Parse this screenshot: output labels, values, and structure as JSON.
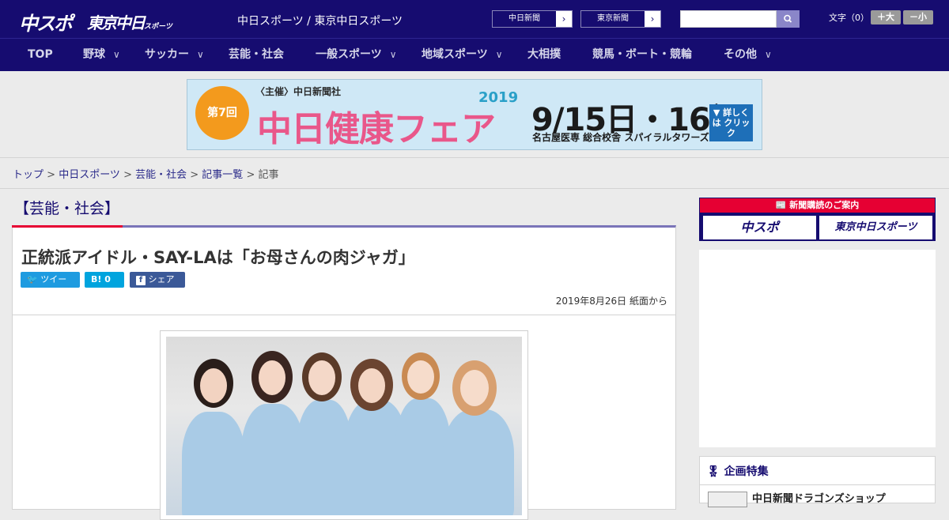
{
  "header": {
    "logo_chuspo": "中スポ",
    "logo_tokyo": "東京中日",
    "logo_tokyo_small": "スポーツ",
    "site_name": "中日スポーツ / 東京中日スポーツ",
    "link_chunichi": "中日新聞",
    "link_tokyo": "東京新聞",
    "arrow": "›",
    "search_icon": "search-icon",
    "font_label": "文字（0）",
    "font_large": "＋大",
    "font_small": "－小"
  },
  "nav": {
    "chevron": "∨",
    "items": [
      {
        "label": "TOP"
      },
      {
        "label": "野球"
      },
      {
        "label": "サッカー"
      },
      {
        "label": "芸能・社会"
      },
      {
        "label": "一般スポーツ"
      },
      {
        "label": "地域スポーツ"
      },
      {
        "label": "大相撲"
      },
      {
        "label": "競馬・ボート・競輪"
      },
      {
        "label": "その他"
      }
    ]
  },
  "banner": {
    "badge": "第7回",
    "organizer": "〈主催〉中日新聞社",
    "title": "中日健康フェア",
    "year": "2019",
    "dates": "9/15日・16祝",
    "place": "名古屋医専 総合校舎 スパイラルタワーズ",
    "more": "▼ 詳しくは クリック"
  },
  "breadcrumb": {
    "items": [
      "トップ",
      "中日スポーツ",
      "芸能・社会",
      "記事一覧"
    ],
    "current": "記事",
    "sep": " > "
  },
  "article": {
    "category": "【芸能・社会】",
    "title": "正統派アイドル・SAY-LAは「お母さんの肉ジャガ」",
    "tweet": "ツイート",
    "hatena": "B! 0",
    "facebook": "シェア 0",
    "date": "2019年8月26日 紙面から"
  },
  "sidebar": {
    "subscribe_header": "新聞購読のご案内",
    "subscribe_chuspo": "中スポ",
    "subscribe_tokyo": "東京中日スポーツ",
    "feature_header": "企画特集",
    "feature_item": "中日新聞ドラゴンズショップ"
  }
}
